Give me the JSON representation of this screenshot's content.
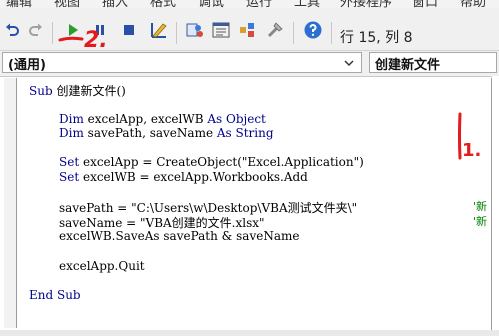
{
  "menubar": {
    "items": [
      "编辑",
      "视图",
      "插入",
      "格式",
      "调试",
      "运行",
      "工具",
      "外接程序",
      "窗口",
      "帮助"
    ]
  },
  "toolbar": {
    "buttons": [
      {
        "icon": "undo-icon"
      },
      {
        "icon": "redo-icon"
      },
      {
        "icon": "run-icon"
      },
      {
        "icon": "break-icon"
      },
      {
        "icon": "reset-icon"
      },
      {
        "icon": "design-mode-icon"
      },
      {
        "icon": "project-explorer-icon"
      },
      {
        "icon": "properties-window-icon"
      },
      {
        "icon": "object-browser-icon"
      },
      {
        "icon": "toolbox-icon"
      },
      {
        "icon": "help-icon"
      }
    ],
    "cursor_position": "行 15, 列 8"
  },
  "dropdowns": {
    "object_value": "(通用)",
    "procedure_value": "创建新文件"
  },
  "code": {
    "lines": [
      {
        "kw": "Sub ",
        "text": "创建新文件()"
      },
      {
        "kw": "",
        "text": ""
      },
      {
        "kw": "Dim ",
        "text": "excelApp, excelWB ",
        "kw2": "As Object"
      },
      {
        "kw": "Dim ",
        "text": "savePath, saveName ",
        "kw2": "As String"
      },
      {
        "kw": "",
        "text": ""
      },
      {
        "kw": "Set ",
        "text": "excelApp = CreateObject(\"Excel.Application\")"
      },
      {
        "kw": "Set ",
        "text": "excelWB = excelApp.Workbooks.Add"
      },
      {
        "kw": "",
        "text": ""
      },
      {
        "kw": "",
        "text": "savePath = \"C:\\Users\\w\\Desktop\\VBA测试文件夹\\\""
      },
      {
        "kw": "",
        "text": "saveName = \"VBA创建的文件.xlsx\""
      },
      {
        "kw": "",
        "text": "excelWB.SaveAs savePath & saveName"
      },
      {
        "kw": "",
        "text": ""
      },
      {
        "kw": "",
        "text": "excelApp.Quit"
      },
      {
        "kw": "",
        "text": ""
      },
      {
        "kw": "End Sub",
        "text": ""
      }
    ],
    "comments": [
      "'新",
      "'新"
    ]
  },
  "annotations": {
    "step1": "1.",
    "step2": "2.",
    "color": "#e31b1b"
  },
  "colors": {
    "keyword": "#00008b",
    "comment": "#008000",
    "run_green": "#2a9d2a",
    "break_blue": "#2b4fa8"
  }
}
